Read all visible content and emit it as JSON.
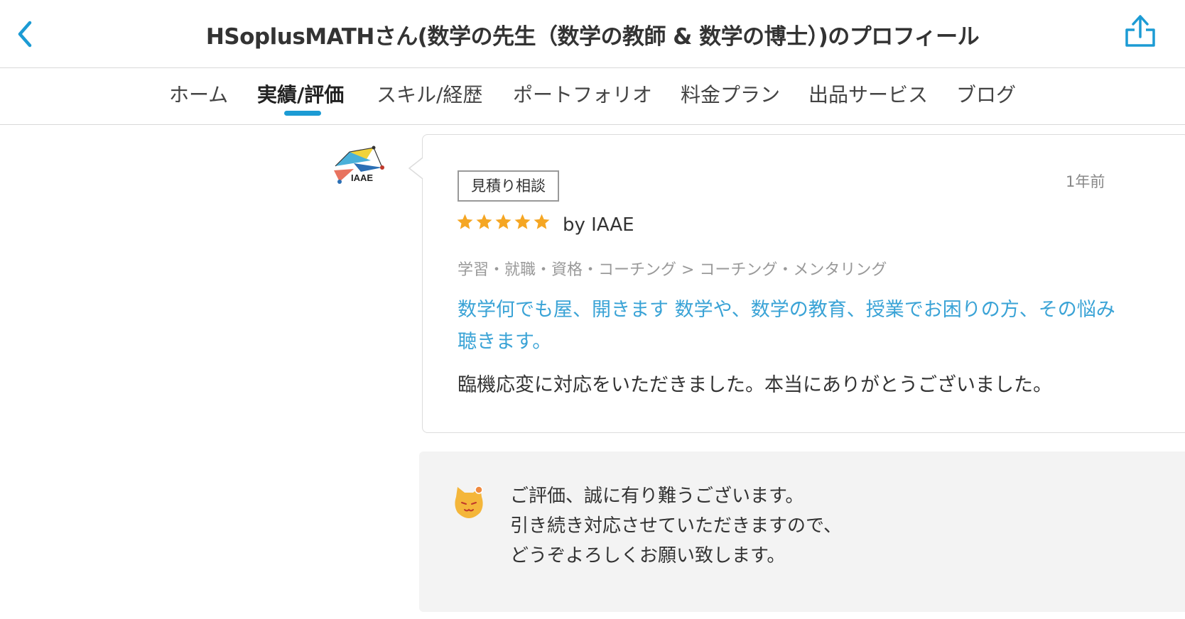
{
  "header": {
    "title": "HSoplusMATHさん(数学の先生（数学の教師 & 数学の博士）)のプロフィール",
    "back_icon": "chevron-left-icon",
    "share_icon": "share-icon"
  },
  "tabs": [
    {
      "label": "ホーム",
      "active": false
    },
    {
      "label": "実績/評価",
      "active": true
    },
    {
      "label": "スキル/経歴",
      "active": false
    },
    {
      "label": "ポートフォリオ",
      "active": false
    },
    {
      "label": "料金プラン",
      "active": false
    },
    {
      "label": "出品サービス",
      "active": false
    },
    {
      "label": "ブログ",
      "active": false
    }
  ],
  "review": {
    "reviewer_logo_text": "IAAE",
    "tag": "見積り相談",
    "time_ago": "1年前",
    "rating": 5,
    "reviewer": "by IAAE",
    "category": "学習・就職・資格・コーチング > コーチング・メンタリング",
    "service_title_line1": "数学何でも屋、開きます 数学や、数学の教育、授業でお困りの方、その悩み",
    "service_title_line2": "聴きます。",
    "text": "臨機応変に対応をいただきました。本当にありがとうございました。"
  },
  "reply": {
    "lines": [
      "ご評価、誠に有り難うございます。",
      "引き続き対応させていただきますので、",
      "どうぞよろしくお願い致します。"
    ]
  },
  "colors": {
    "accent": "#1c9bd4",
    "link": "#3aa3d6",
    "star": "#f5a623",
    "reply_bg": "#f3f3f3"
  }
}
